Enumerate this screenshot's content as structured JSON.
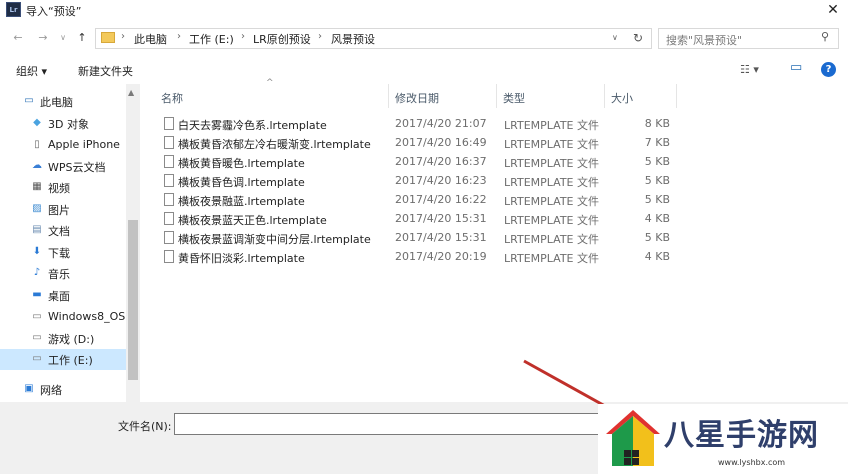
{
  "window": {
    "app_icon": "Lr",
    "title": "导入“预设”",
    "close": "✕"
  },
  "nav": {
    "back": "←",
    "forward": "→",
    "dropdown": "∨",
    "up": "↑",
    "breadcrumb": [
      "此电脑",
      "工作 (E:)",
      "LR原创预设",
      "风景预设"
    ],
    "crumb_sep": "›",
    "addr_dropdown": "∨",
    "refresh": "↻",
    "search_placeholder": "搜索\"风景预设\"",
    "search_icon": "⚲"
  },
  "toolbar": {
    "organize": "组织 ▾",
    "new_folder": "新建文件夹",
    "view": "☷ ▾",
    "pane": "▭",
    "help": "?"
  },
  "sidebar": {
    "items": [
      {
        "label": "此电脑",
        "icon": "computer-icon",
        "glyph": "▭",
        "color": "#2a6fb5"
      },
      {
        "label": "3D 对象",
        "icon": "3d-objects-icon",
        "glyph": "◆",
        "color": "#4aa3e0"
      },
      {
        "label": "Apple iPhone",
        "icon": "phone-icon",
        "glyph": "▯",
        "color": "#666666"
      },
      {
        "label": "WPS云文档",
        "icon": "cloud-icon",
        "glyph": "☁",
        "color": "#3a7fd5"
      },
      {
        "label": "视频",
        "icon": "video-icon",
        "glyph": "▦",
        "color": "#555555"
      },
      {
        "label": "图片",
        "icon": "pictures-icon",
        "glyph": "▨",
        "color": "#3c8ad0"
      },
      {
        "label": "文档",
        "icon": "documents-icon",
        "glyph": "▤",
        "color": "#6a8bb0"
      },
      {
        "label": "下载",
        "icon": "download-icon",
        "glyph": "⬇",
        "color": "#2a7ad5"
      },
      {
        "label": "音乐",
        "icon": "music-icon",
        "glyph": "♪",
        "color": "#2a7ad5"
      },
      {
        "label": "桌面",
        "icon": "desktop-icon",
        "glyph": "▬",
        "color": "#2a7ad5"
      },
      {
        "label": "Windows8_OS",
        "icon": "drive-icon",
        "glyph": "▭",
        "color": "#777777"
      },
      {
        "label": "游戏 (D:)",
        "icon": "drive-icon",
        "glyph": "▭",
        "color": "#777777"
      },
      {
        "label": "工作 (E:)",
        "icon": "drive-icon",
        "glyph": "▭",
        "color": "#777777",
        "selected": true
      },
      {
        "label": "网络",
        "icon": "network-icon",
        "glyph": "▣",
        "color": "#2a7ad5"
      }
    ]
  },
  "columns": {
    "name": "名称",
    "date": "修改日期",
    "type": "类型",
    "size": "大小",
    "sort_indicator": "^"
  },
  "files": [
    {
      "name": "白天去雾霾冷色系.lrtemplate",
      "date": "2017/4/20 21:07",
      "type": "LRTEMPLATE 文件",
      "size": "8 KB"
    },
    {
      "name": "横板黄昏浓郁左冷右暖渐变.lrtemplate",
      "date": "2017/4/20 16:49",
      "type": "LRTEMPLATE 文件",
      "size": "7 KB"
    },
    {
      "name": "横板黄昏暖色.lrtemplate",
      "date": "2017/4/20 16:37",
      "type": "LRTEMPLATE 文件",
      "size": "5 KB"
    },
    {
      "name": "横板黄昏色调.lrtemplate",
      "date": "2017/4/20 16:23",
      "type": "LRTEMPLATE 文件",
      "size": "5 KB"
    },
    {
      "name": "横板夜景融蓝.lrtemplate",
      "date": "2017/4/20 16:22",
      "type": "LRTEMPLATE 文件",
      "size": "5 KB"
    },
    {
      "name": "横板夜景蓝天正色.lrtemplate",
      "date": "2017/4/20 15:31",
      "type": "LRTEMPLATE 文件",
      "size": "4 KB"
    },
    {
      "name": "横板夜景蓝调渐变中间分层.lrtemplate",
      "date": "2017/4/20 15:31",
      "type": "LRTEMPLATE 文件",
      "size": "5 KB"
    },
    {
      "name": "黄昏怀旧淡彩.lrtemplate",
      "date": "2017/4/20 20:19",
      "type": "LRTEMPLATE 文件",
      "size": "4 KB"
    }
  ],
  "bottom": {
    "filename_label": "文件名(N):",
    "filename_value": ""
  },
  "watermark": {
    "text": "八星手游网",
    "url": "www.lyshbx.com"
  }
}
